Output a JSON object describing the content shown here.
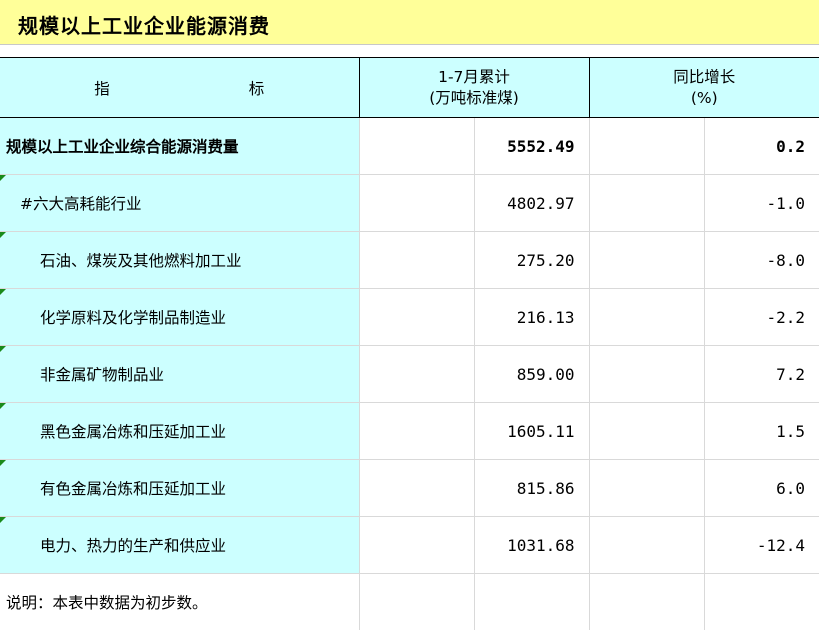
{
  "title": "规模以上工业企业能源消费",
  "header": {
    "indicator_left": "指",
    "indicator_right": "标",
    "cumulative_line1": "1-7月累计",
    "cumulative_line2": "(万吨标准煤)",
    "growth_line1": "同比增长",
    "growth_line2": "(%)"
  },
  "rows": [
    {
      "name": "规模以上工业企业综合能源消费量",
      "value": "5552.49",
      "growth": "0.2"
    },
    {
      "name": "#六大高耗能行业",
      "value": "4802.97",
      "growth": "-1.0"
    },
    {
      "name": "石油、煤炭及其他燃料加工业",
      "value": "275.20",
      "growth": "-8.0"
    },
    {
      "name": "化学原料及化学制品制造业",
      "value": "216.13",
      "growth": "-2.2"
    },
    {
      "name": "非金属矿物制品业",
      "value": "859.00",
      "growth": "7.2"
    },
    {
      "name": "黑色金属冶炼和压延加工业",
      "value": "1605.11",
      "growth": "1.5"
    },
    {
      "name": "有色金属冶炼和压延加工业",
      "value": "815.86",
      "growth": "6.0"
    },
    {
      "name": "电力、热力的生产和供应业",
      "value": "1031.68",
      "growth": "-12.4"
    }
  ],
  "note": "说明：本表中数据为初步数。",
  "colors": {
    "title_bg": "#ffff99",
    "label_bg": "#ccffff",
    "comment_marker": "#1a8a1a"
  }
}
